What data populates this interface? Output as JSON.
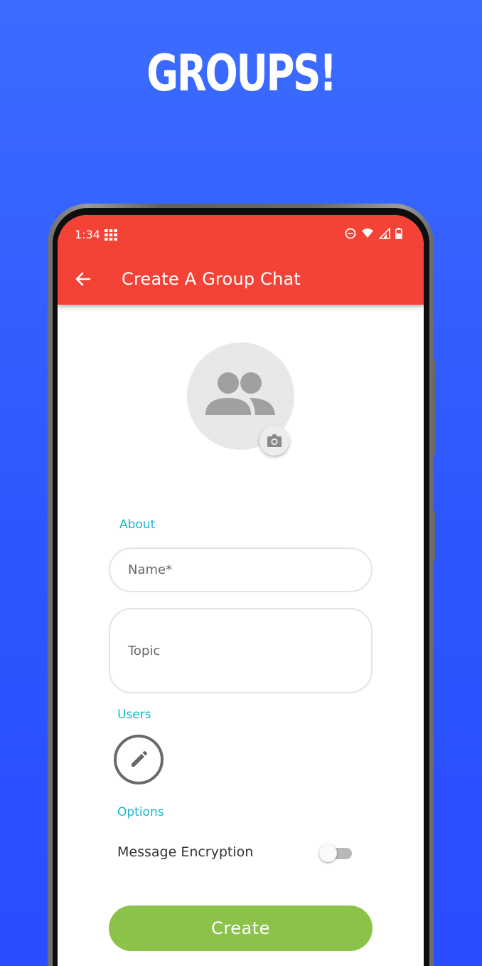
{
  "promo": {
    "headline": "GROUPS!"
  },
  "colors": {
    "background": "#3160ff",
    "appbar": "#f44336",
    "accent": "#17b8c8",
    "create_button": "#8bc34a"
  },
  "status_bar": {
    "time": "1:34",
    "icons": [
      "grid-icon",
      "dnd-icon",
      "wifi-icon",
      "signal-icon",
      "battery-icon"
    ]
  },
  "appbar": {
    "back_icon": "arrow-left-icon",
    "title": "Create A Group Chat"
  },
  "avatar": {
    "icon": "group-icon",
    "camera_icon": "camera-icon"
  },
  "form": {
    "about_label": "About",
    "name_placeholder": "Name*",
    "topic_placeholder": "Topic",
    "users_label": "Users",
    "edit_users_icon": "pencil-icon",
    "options_label": "Options",
    "message_encryption_label": "Message Encryption",
    "message_encryption_enabled": false,
    "create_label": "Create"
  }
}
